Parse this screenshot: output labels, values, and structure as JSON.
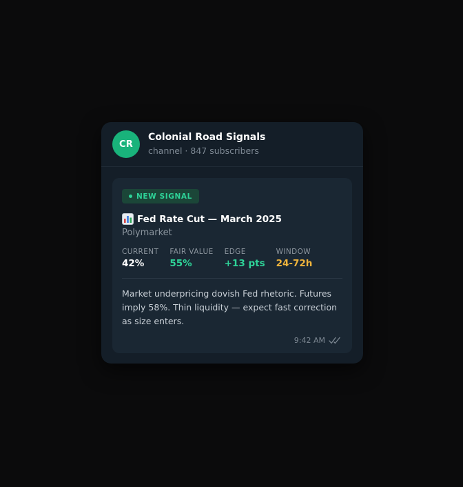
{
  "channel": {
    "avatar_initials": "CR",
    "name": "Colonial Road Signals",
    "meta": "channel · 847 subscribers"
  },
  "message": {
    "badge": "NEW SIGNAL",
    "title_icon": "bar-chart-icon",
    "title": "Fed Rate Cut — March 2025",
    "platform": "Polymarket",
    "stats": [
      {
        "label": "CURRENT",
        "value": "42%"
      },
      {
        "label": "FAIR VALUE",
        "value": "55%"
      },
      {
        "label": "EDGE",
        "value": "+13 pts"
      },
      {
        "label": "WINDOW",
        "value": "24-72h"
      }
    ],
    "body": "Market underpricing dovish Fed rhetoric. Futures imply 58%. Thin liquidity — expect fast correction as size enters.",
    "time": "9:42 AM",
    "status_icon": "double-check-icon"
  },
  "colors": {
    "avatar": "#19b37b",
    "accent_green": "#2ed398",
    "window_orange": "#f0b43c",
    "card_bg": "#141e28",
    "bubble_bg": "#1a2733"
  }
}
